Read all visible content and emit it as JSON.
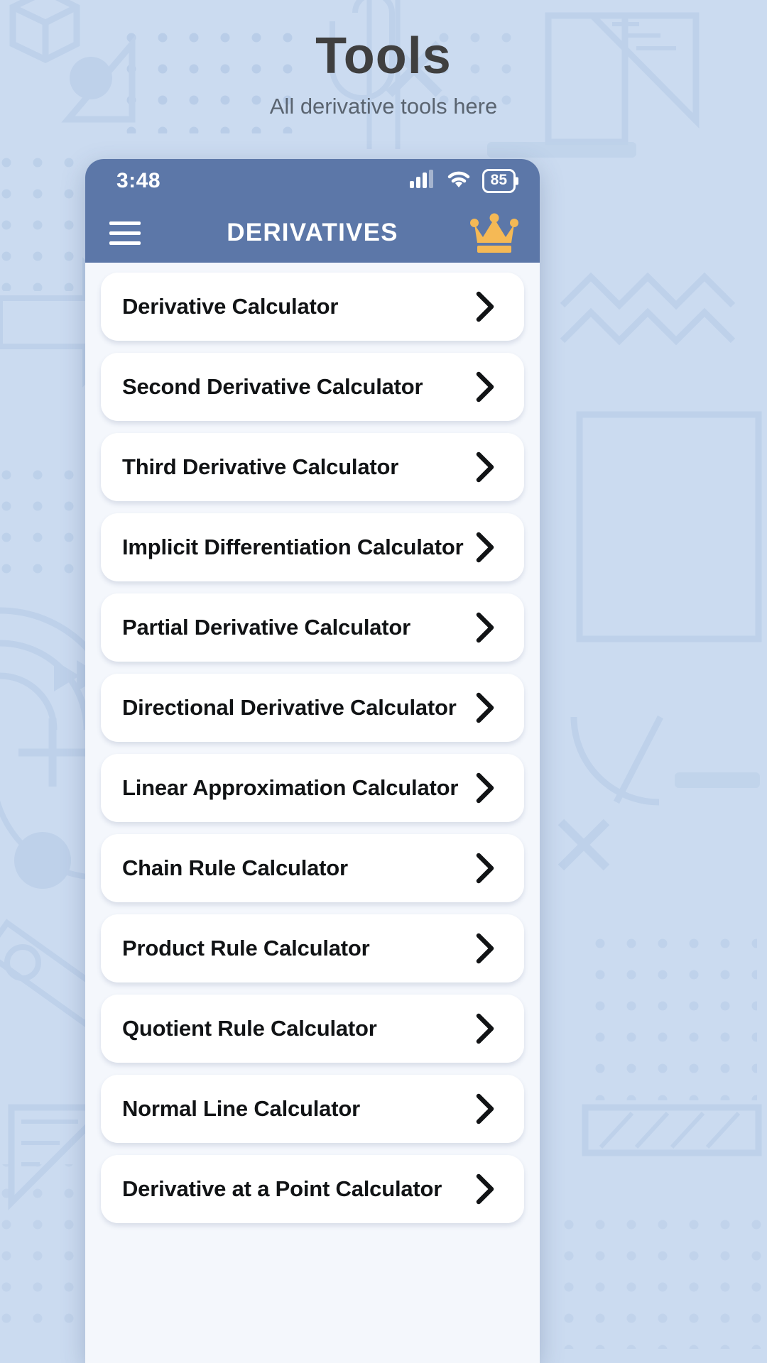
{
  "banner": {
    "title": "Tools",
    "subtitle": "All derivative tools here"
  },
  "phone": {
    "statusbar": {
      "time": "3:48",
      "battery_level": "85",
      "signal_icon": "cellular-signal-icon",
      "wifi_icon": "wifi-icon",
      "battery_icon": "battery-icon"
    },
    "appbar": {
      "menu_icon": "hamburger-menu-icon",
      "title": "DERIVATIVES",
      "premium_icon": "crown-icon"
    },
    "list": {
      "chevron_icon": "chevron-right-icon",
      "items": [
        {
          "label": "Derivative Calculator"
        },
        {
          "label": "Second Derivative Calculator"
        },
        {
          "label": "Third Derivative Calculator"
        },
        {
          "label": "Implicit Differentiation Calculator"
        },
        {
          "label": "Partial Derivative Calculator"
        },
        {
          "label": "Directional Derivative Calculator"
        },
        {
          "label": "Linear Approximation Calculator"
        },
        {
          "label": "Chain Rule Calculator"
        },
        {
          "label": "Product Rule Calculator"
        },
        {
          "label": "Quotient Rule Calculator"
        },
        {
          "label": "Normal Line Calculator"
        },
        {
          "label": "Derivative at a Point Calculator"
        }
      ]
    }
  },
  "colors": {
    "background": "#cbdbf0",
    "header_blue": "#5c77a8",
    "crown_gold": "#f5b955",
    "card_white": "#ffffff",
    "title_gray": "#3f3f3f"
  }
}
